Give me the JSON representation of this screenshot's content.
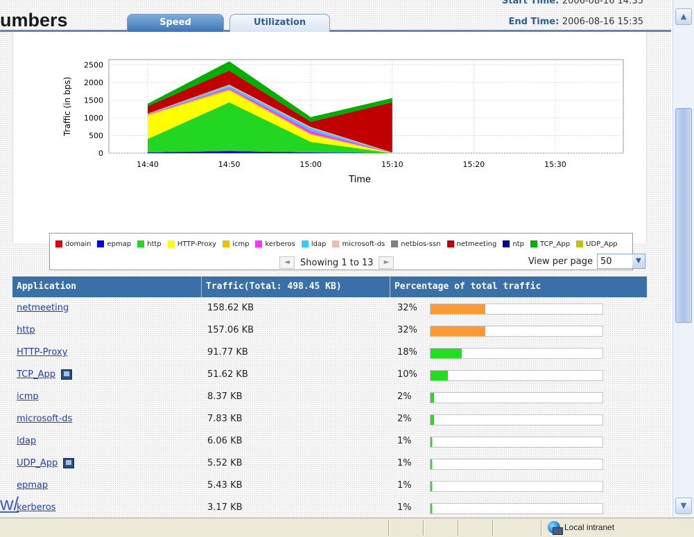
{
  "overlay": {
    "heading_fragment": "umbers",
    "link_fragment": "w/"
  },
  "tabs": {
    "speed": "Speed",
    "utilization": "Utilization"
  },
  "times": {
    "start_label": "Start Time:",
    "start_value": "2006-08-16 14:35",
    "end_label": "End Time:",
    "end_value": "2006-08-16 15:35"
  },
  "chart_data": {
    "type": "area",
    "xlabel": "Time",
    "ylabel": "Traffic (in bps)",
    "x": [
      "14:40",
      "14:50",
      "15:00",
      "15:10",
      "15:20",
      "15:30"
    ],
    "yticks": [
      0,
      500,
      1000,
      1500,
      2000,
      2500
    ],
    "ylim": [
      0,
      2650
    ],
    "grid": true,
    "legend_position": "bottom",
    "series": [
      {
        "name": "domain",
        "color": "#e60000",
        "values": [
          0,
          0,
          0,
          0
        ]
      },
      {
        "name": "epmap",
        "color": "#0000e6",
        "values": [
          20,
          60,
          20,
          0
        ]
      },
      {
        "name": "http",
        "color": "#22d622",
        "values": [
          380,
          1380,
          300,
          0
        ]
      },
      {
        "name": "HTTP-Proxy",
        "color": "#ffff00",
        "values": [
          660,
          330,
          200,
          0
        ]
      },
      {
        "name": "icmp",
        "color": "#f0c000",
        "values": [
          30,
          40,
          30,
          0
        ]
      },
      {
        "name": "kerberos",
        "color": "#ff33ff",
        "values": [
          10,
          40,
          80,
          0
        ]
      },
      {
        "name": "ldap",
        "color": "#33ccff",
        "values": [
          10,
          60,
          80,
          10
        ]
      },
      {
        "name": "microsoft-ds",
        "color": "#f4b8b0",
        "values": [
          10,
          30,
          30,
          10
        ]
      },
      {
        "name": "netbios-ssn",
        "color": "#808080",
        "values": [
          0,
          0,
          0,
          0
        ]
      },
      {
        "name": "netmeeting",
        "color": "#c00000",
        "values": [
          210,
          400,
          150,
          1420
        ]
      },
      {
        "name": "ntp",
        "color": "#0000a0",
        "values": [
          0,
          0,
          0,
          0
        ]
      },
      {
        "name": "TCP_App",
        "color": "#00b000",
        "values": [
          70,
          260,
          130,
          120
        ]
      },
      {
        "name": "UDP_App",
        "color": "#c8c000",
        "values": [
          0,
          0,
          0,
          0
        ]
      }
    ]
  },
  "pager": {
    "text": "Showing 1 to 13",
    "prev": "◄",
    "next": "►",
    "per_page_label": "View per page",
    "per_page_value": "50"
  },
  "table": {
    "headers": [
      "Application",
      "Traffic(Total: 498.45 KB)",
      "Percentage of total traffic"
    ],
    "rows": [
      {
        "app": "netmeeting",
        "traffic": "158.62 KB",
        "pct_text": "32%",
        "pct": 32,
        "color": "#ff9933",
        "icon": false
      },
      {
        "app": "http",
        "traffic": "157.06 KB",
        "pct_text": "32%",
        "pct": 32,
        "color": "#ff9933",
        "icon": false
      },
      {
        "app": "HTTP-Proxy",
        "traffic": "91.77 KB",
        "pct_text": "18%",
        "pct": 18,
        "color": "#22dd22",
        "icon": false
      },
      {
        "app": "TCP_App",
        "traffic": "51.62 KB",
        "pct_text": "10%",
        "pct": 10,
        "color": "#22dd22",
        "icon": true
      },
      {
        "app": "icmp",
        "traffic": "8.37 KB",
        "pct_text": "2%",
        "pct": 2,
        "color": "#22dd22",
        "icon": false
      },
      {
        "app": "microsoft-ds",
        "traffic": "7.83 KB",
        "pct_text": "2%",
        "pct": 2,
        "color": "#22dd22",
        "icon": false
      },
      {
        "app": "ldap",
        "traffic": "6.06 KB",
        "pct_text": "1%",
        "pct": 1,
        "color": "#22dd22",
        "icon": false
      },
      {
        "app": "UDP_App",
        "traffic": "5.52 KB",
        "pct_text": "1%",
        "pct": 1,
        "color": "#22dd22",
        "icon": true
      },
      {
        "app": "epmap",
        "traffic": "5.43 KB",
        "pct_text": "1%",
        "pct": 1,
        "color": "#22dd22",
        "icon": false
      },
      {
        "app": "kerberos",
        "traffic": "3.17 KB",
        "pct_text": "1%",
        "pct": 1,
        "color": "#22dd22",
        "icon": false
      }
    ]
  },
  "status": {
    "zone": "Local intranet"
  }
}
